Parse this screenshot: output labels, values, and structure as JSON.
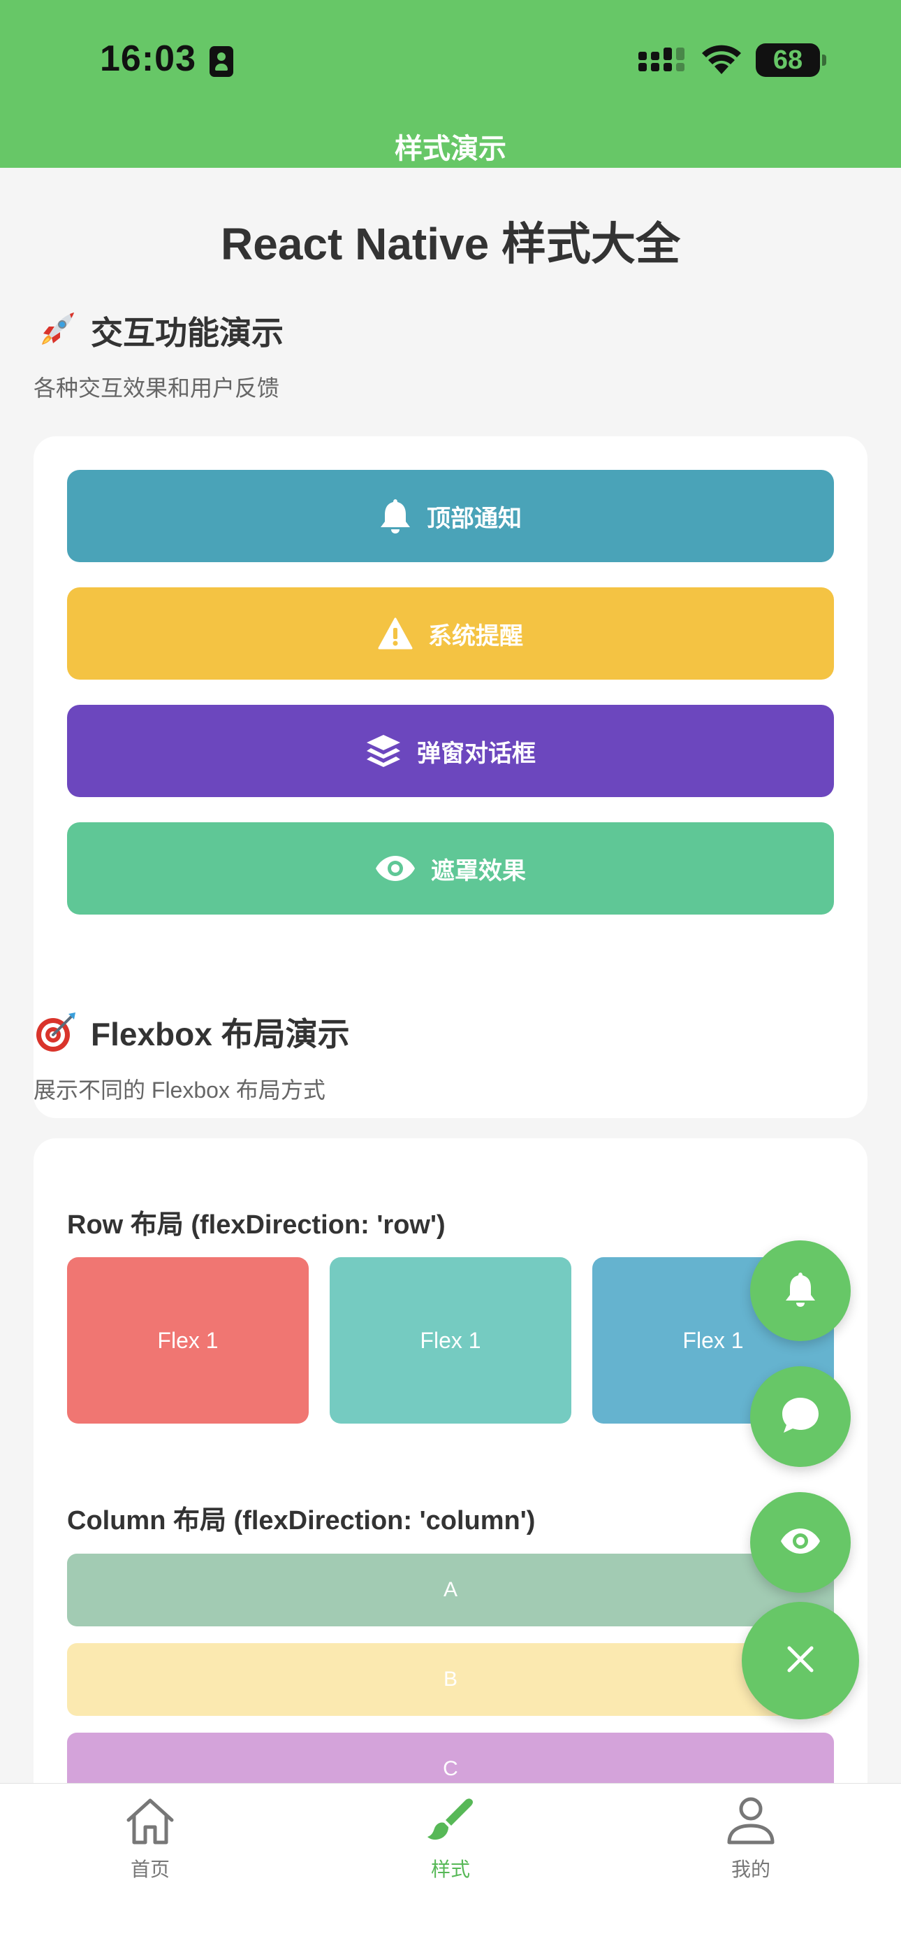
{
  "status_bar": {
    "time": "16:03",
    "battery": "68"
  },
  "nav": {
    "title": "样式演示"
  },
  "page": {
    "title": "React Native 样式大全"
  },
  "interaction_section": {
    "title": "交互功能演示",
    "subtitle": "各种交互效果和用户反馈",
    "buttons": [
      {
        "label": "顶部通知",
        "icon": "bell-icon",
        "color": "#4aa3b8"
      },
      {
        "label": "系统提醒",
        "icon": "warning-icon",
        "color": "#f4c343"
      },
      {
        "label": "弹窗对话框",
        "icon": "layers-icon",
        "color": "#6c47be"
      },
      {
        "label": "遮罩效果",
        "icon": "eye-icon",
        "color": "#5fc796"
      }
    ]
  },
  "flexbox_section": {
    "title": "Flexbox 布局演示",
    "subtitle": "展示不同的 Flexbox 布局方式",
    "row_demo": {
      "label": "Row 布局 (flexDirection: 'row')",
      "boxes": [
        {
          "label": "Flex 1",
          "color": "#f07672"
        },
        {
          "label": "Flex 1",
          "color": "#75cbc1"
        },
        {
          "label": "Flex 1",
          "color": "#65b3cf"
        }
      ]
    },
    "column_demo": {
      "label": "Column 布局 (flexDirection: 'column')",
      "boxes": [
        {
          "label": "A",
          "color": "#a2cbb3"
        },
        {
          "label": "B",
          "color": "#fbe9b0"
        },
        {
          "label": "C",
          "color": "#d4a3da"
        }
      ]
    }
  },
  "fab_menu": {
    "items": [
      "bell-icon",
      "chat-bubble-icon",
      "eye-icon"
    ],
    "main": "close-icon",
    "color": "#67c767"
  },
  "tabbar": {
    "tabs": [
      {
        "label": "首页",
        "icon": "home-icon",
        "active": false
      },
      {
        "label": "样式",
        "icon": "brush-icon",
        "active": true
      },
      {
        "label": "我的",
        "icon": "user-icon",
        "active": false
      }
    ],
    "active_color": "#57b857"
  }
}
